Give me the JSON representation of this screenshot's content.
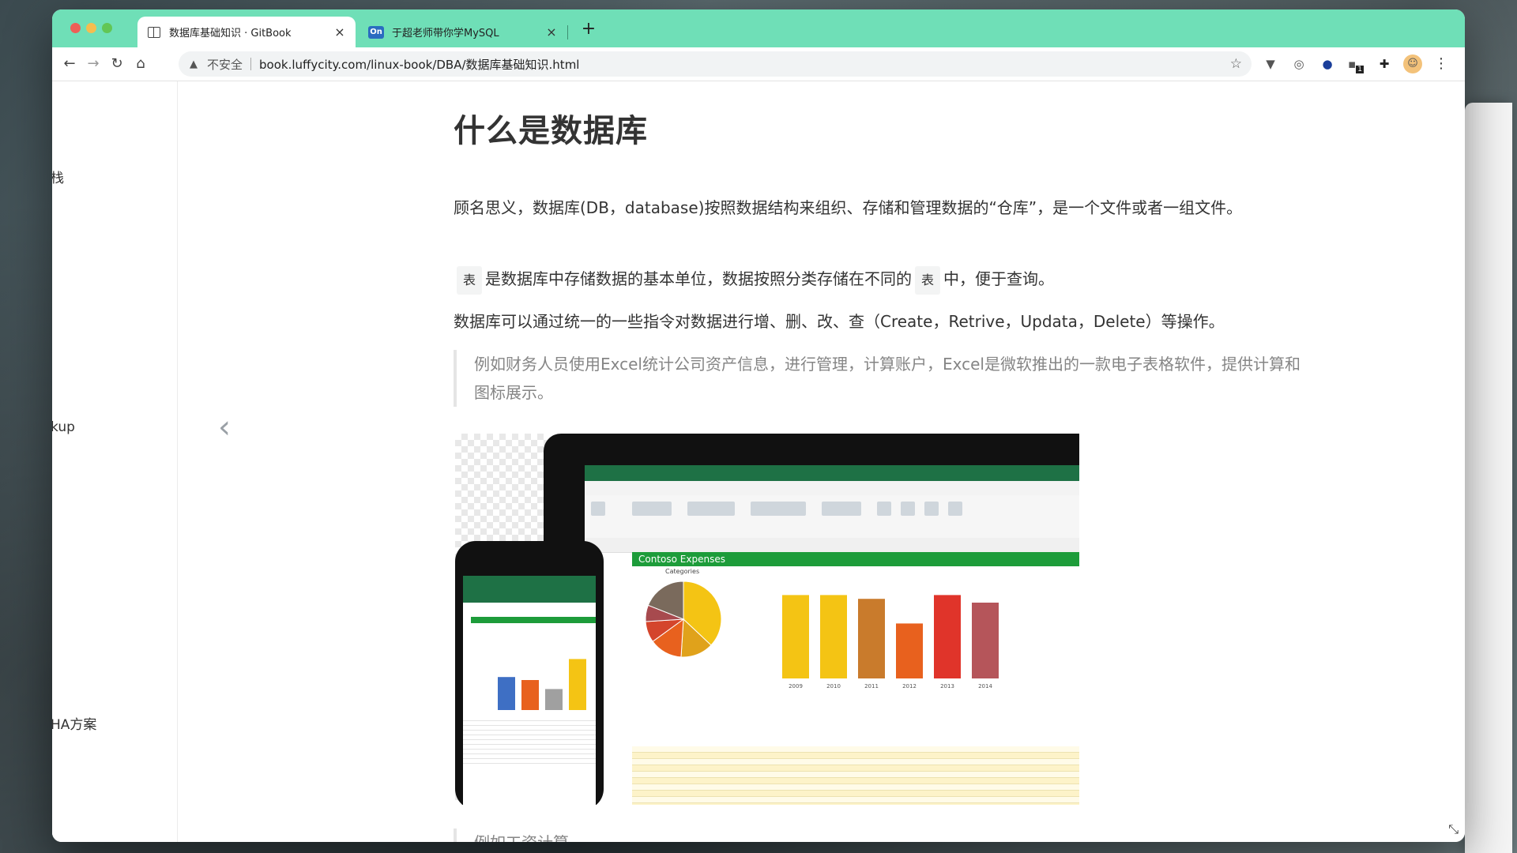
{
  "browser": {
    "tabs": [
      {
        "title": "数据库基础知识 · GitBook",
        "active": true,
        "favicon": "book-icon"
      },
      {
        "title": "于超老师带你学MySQL",
        "active": false,
        "favicon": "On"
      }
    ],
    "tab_close": "×",
    "new_tab": "+",
    "address": {
      "security_label": "不安全",
      "url": "book.luffycity.com/linux-book/DBA/数据库基础知识.html"
    },
    "accent_color": "#6fdfb7",
    "extension_badge": "1"
  },
  "sidebar": {
    "items": [
      {
        "label": "栈"
      },
      {
        "label": "kup"
      },
      {
        "label": "HA方案"
      }
    ]
  },
  "article": {
    "title": "什么是数据库",
    "p1": "顾名思义，数据库(DB，database)按照数据结构来组织、存储和管理数据的“仓库”，是一个文件或者一组文件。",
    "p2_code1": "表",
    "p2_mid": "是数据库中存储数据的基本单位，数据按照分类存储在不同的",
    "p2_code2": "表",
    "p2_end": "中，便于查询。",
    "p3": "数据库可以通过统一的一些指令对数据进行增、删、改、查（Create，Retrive，Updata，Delete）等操作。",
    "quote1": "例如财务人员使用Excel统计公司资产信息，进行管理，计算账户，Excel是微软推出的一款电子表格软件，提供计算和图标展示。",
    "quote2": "例如工资计算"
  },
  "figure": {
    "sheet_title": "Contoso Expenses",
    "chart_title": "Categories",
    "bar_colors": [
      "#f4c414",
      "#f4c414",
      "#c97b2c",
      "#e8611e",
      "#e0342a",
      "#b5555a"
    ],
    "bars": [
      {
        "label": "2009",
        "value": 0.88
      },
      {
        "label": "2010",
        "value": 0.88
      },
      {
        "label": "2011",
        "value": 0.84
      },
      {
        "label": "2012",
        "value": 0.58
      },
      {
        "label": "2013",
        "value": 0.88
      },
      {
        "label": "2014",
        "value": 0.8
      }
    ],
    "pie": [
      0.37,
      0.14,
      0.14,
      0.09,
      0.07,
      0.19
    ],
    "pie_colors": [
      "#f4c414",
      "#e0a21b",
      "#e8611e",
      "#d4452c",
      "#a74a4e",
      "#7a6a5c"
    ],
    "phone_bars": [
      0.55,
      0.5,
      0.35,
      0.85
    ],
    "phone_bar_colors": [
      "#3e6fc4",
      "#e8611e",
      "#a0a0a0",
      "#f4c414"
    ]
  }
}
